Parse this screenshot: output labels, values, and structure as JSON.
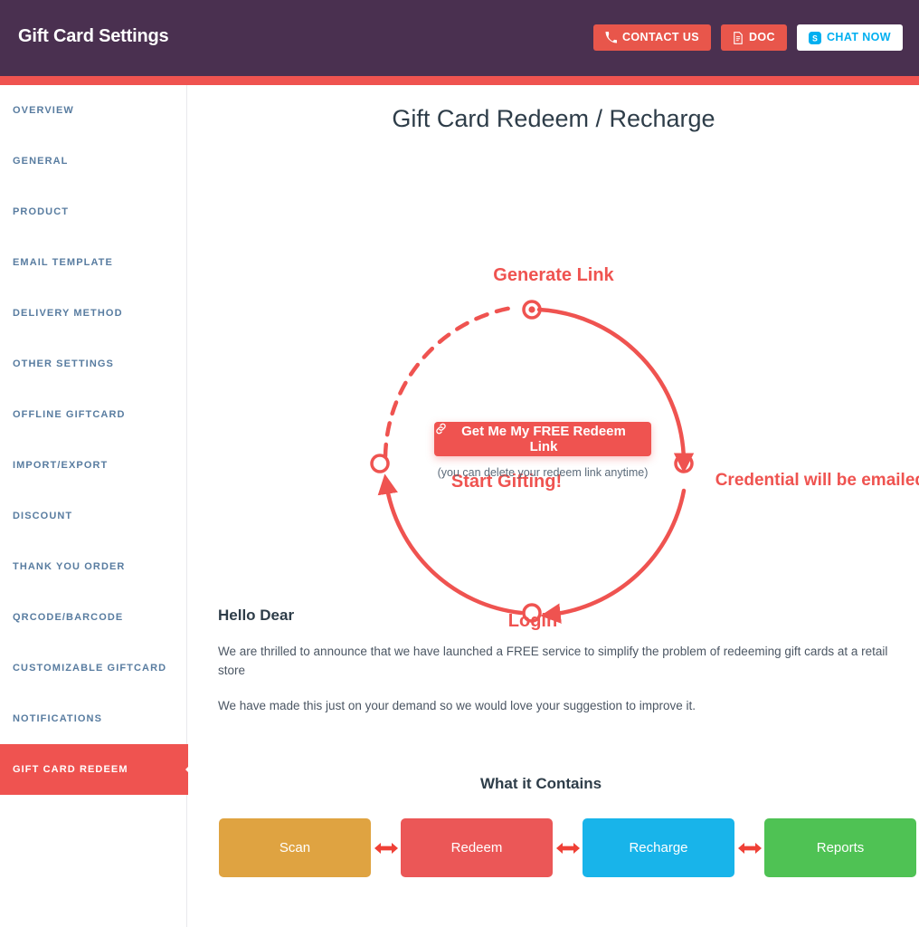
{
  "header": {
    "title": "Gift Card Settings",
    "buttons": [
      {
        "label": "CONTACT US",
        "icon": "phone-icon",
        "style": "red"
      },
      {
        "label": "DOC",
        "icon": "document-icon",
        "style": "red"
      },
      {
        "label": "CHAT NOW",
        "icon": "skype-icon",
        "style": "white"
      }
    ],
    "bar_color": "#4a3050",
    "stripe_color": "#ef5350"
  },
  "sidebar": {
    "items": [
      {
        "label": "OVERVIEW",
        "active": false
      },
      {
        "label": "GENERAL",
        "active": false
      },
      {
        "label": "PRODUCT",
        "active": false
      },
      {
        "label": "EMAIL TEMPLATE",
        "active": false
      },
      {
        "label": "DELIVERY METHOD",
        "active": false
      },
      {
        "label": "OTHER SETTINGS",
        "active": false
      },
      {
        "label": "OFFLINE GIFTCARD",
        "active": false
      },
      {
        "label": "IMPORT/EXPORT",
        "active": false
      },
      {
        "label": "DISCOUNT",
        "active": false
      },
      {
        "label": "THANK YOU ORDER",
        "active": false
      },
      {
        "label": "QRCODE/BARCODE",
        "active": false
      },
      {
        "label": "CUSTOMIZABLE GIFTCARD",
        "active": false
      },
      {
        "label": "NOTIFICATIONS",
        "active": false
      },
      {
        "label": "GIFT CARD REDEEM",
        "active": true
      }
    ],
    "link_color": "#587ca0",
    "active_color": "#ef5350"
  },
  "main": {
    "page_title": "Gift Card Redeem / Recharge",
    "diagram": {
      "accent_color": "#ef5350",
      "nodes": [
        {
          "label": "Generate Link",
          "position": "top",
          "marker": "filled-target"
        },
        {
          "label": "Credential will be emailed to you",
          "position": "right",
          "marker": "ring"
        },
        {
          "label": "Login",
          "position": "bottom",
          "marker": "ring"
        },
        {
          "label": "Start Gifting!",
          "position": "left",
          "marker": "ring"
        }
      ],
      "edges": [
        {
          "from": "Generate Link",
          "to": "Credential will be emailed to you",
          "style": "solid",
          "arrow": true
        },
        {
          "from": "Credential will be emailed to you",
          "to": "Login",
          "style": "solid",
          "arrow": true
        },
        {
          "from": "Login",
          "to": "Start Gifting!",
          "style": "solid",
          "arrow": true
        },
        {
          "from": "Start Gifting!",
          "to": "Generate Link",
          "style": "dashed",
          "arrow": false
        }
      ],
      "cta_label": "Get Me My FREE Redeem Link",
      "cta_icon": "link-icon",
      "cta_note": "(you can delete your redeem link anytime)"
    },
    "copy": {
      "heading": "Hello Dear",
      "paragraph1": "We are thrilled to announce that we have launched a FREE service to simplify the problem of redeeming gift cards at a retail store",
      "paragraph2": "We have made this just on your demand so we would love your suggestion to improve it."
    },
    "contains": {
      "title": "What it Contains",
      "boxes": [
        {
          "label": "Scan",
          "color": "#dfa341"
        },
        {
          "label": "Redeem",
          "color": "#eb5757"
        },
        {
          "label": "Recharge",
          "color": "#18b4ea"
        },
        {
          "label": "Reports",
          "color": "#4fc254"
        }
      ],
      "separator_color": "#ef4036"
    }
  }
}
